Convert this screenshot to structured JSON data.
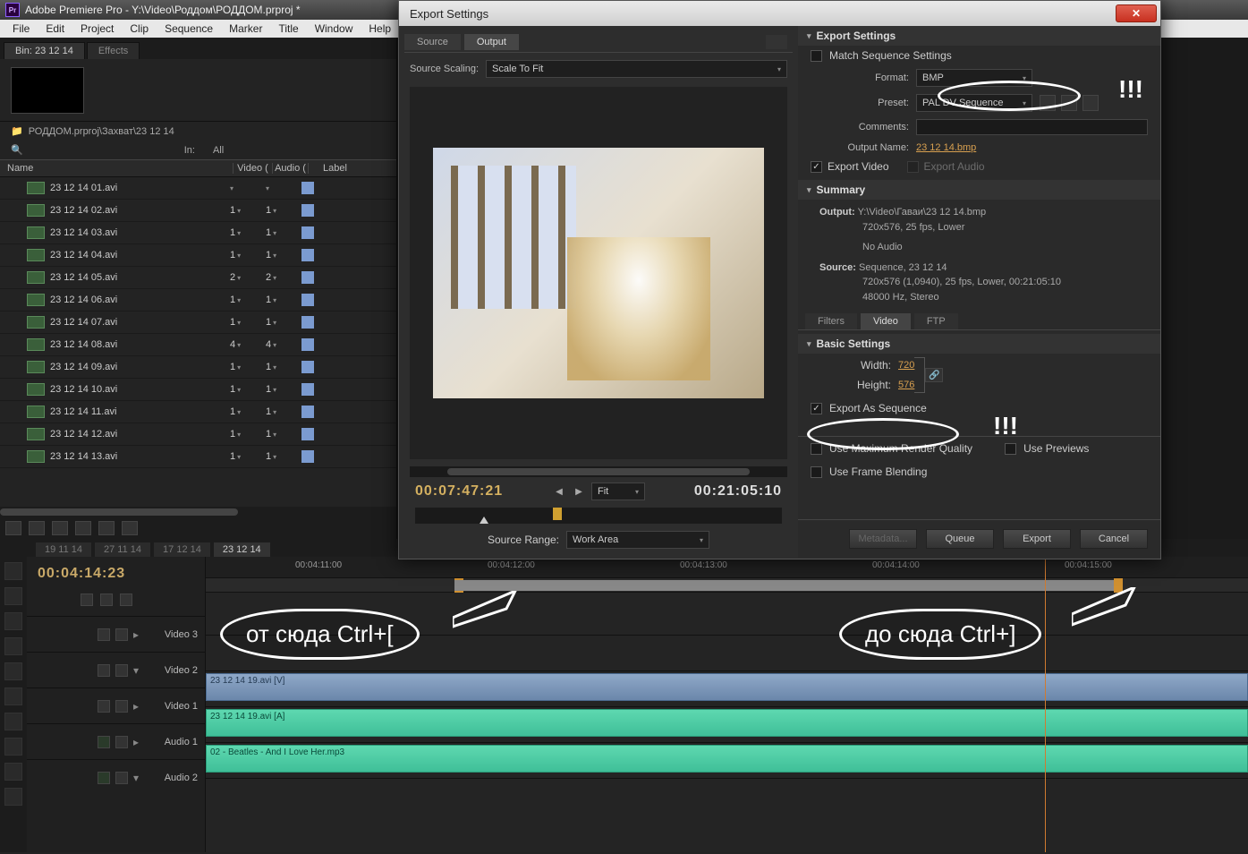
{
  "app": {
    "title": "Adobe Premiere Pro - Y:\\Video\\Роддом\\РОДДОМ.prproj *",
    "logo": "Pr"
  },
  "menu": [
    "File",
    "Edit",
    "Project",
    "Clip",
    "Sequence",
    "Marker",
    "Title",
    "Window",
    "Help"
  ],
  "project": {
    "tabs": [
      {
        "label": "Bin: 23 12 14",
        "active": true
      },
      {
        "label": "Effects",
        "active": false
      }
    ],
    "path_icon": "folder-icon",
    "path": "РОДДОМ.prproj\\Захват\\23 12 14",
    "filter_in": "In:",
    "filter_all": "All",
    "columns": {
      "name": "Name",
      "video": "Video (",
      "audio": "Audio (",
      "label": "Label"
    },
    "files": [
      {
        "name": "23 12 14 01.avi",
        "v": "",
        "a": ""
      },
      {
        "name": "23 12 14 02.avi",
        "v": "1",
        "a": "1"
      },
      {
        "name": "23 12 14 03.avi",
        "v": "1",
        "a": "1"
      },
      {
        "name": "23 12 14 04.avi",
        "v": "1",
        "a": "1"
      },
      {
        "name": "23 12 14 05.avi",
        "v": "2",
        "a": "2"
      },
      {
        "name": "23 12 14 06.avi",
        "v": "1",
        "a": "1"
      },
      {
        "name": "23 12 14 07.avi",
        "v": "1",
        "a": "1"
      },
      {
        "name": "23 12 14 08.avi",
        "v": "4",
        "a": "4"
      },
      {
        "name": "23 12 14 09.avi",
        "v": "1",
        "a": "1"
      },
      {
        "name": "23 12 14 10.avi",
        "v": "1",
        "a": "1"
      },
      {
        "name": "23 12 14 11.avi",
        "v": "1",
        "a": "1"
      },
      {
        "name": "23 12 14 12.avi",
        "v": "1",
        "a": "1"
      },
      {
        "name": "23 12 14 13.avi",
        "v": "1",
        "a": "1"
      }
    ]
  },
  "timeline": {
    "tabs": [
      "19 11 14",
      "27 11 14",
      "17 12 14",
      "23 12 14"
    ],
    "active_tab": 3,
    "timecode": "00:04:14:23",
    "ruler": [
      "00:04:11:00",
      "00:04:12:00",
      "00:04:13:00",
      "00:04:14:00",
      "00:04:15:00"
    ],
    "tracks": {
      "v3": "Video 3",
      "v2": "Video 2",
      "v1": "Video 1",
      "a1": "Audio 1",
      "a2": "Audio 2"
    },
    "clip_v1": "23 12 14 19.avi [V]",
    "clip_a1": "23 12 14 19.avi [A]",
    "clip_a2": "02 - Beatles - And I Love Her.mp3"
  },
  "export": {
    "title": "Export Settings",
    "source_tab": "Source",
    "output_tab": "Output",
    "scaling_label": "Source Scaling:",
    "scaling_value": "Scale To Fit",
    "tc_in": "00:07:47:21",
    "tc_out": "00:21:05:10",
    "fit": "Fit",
    "range_label": "Source Range:",
    "range_value": "Work Area",
    "section": "Export Settings",
    "match_seq": "Match Sequence Settings",
    "format_label": "Format:",
    "format_value": "BMP",
    "preset_label": "Preset:",
    "preset_value": "PAL DV Sequence",
    "comments_label": "Comments:",
    "output_name_label": "Output Name:",
    "output_name": "23 12 14.bmp",
    "export_video": "Export Video",
    "export_audio": "Export Audio",
    "summary_head": "Summary",
    "summary_output_label": "Output:",
    "summary_output_1": "Y:\\Video\\Гаваи\\23 12 14.bmp",
    "summary_output_2": "720x576, 25 fps, Lower",
    "summary_output_3": "No Audio",
    "summary_source_label": "Source:",
    "summary_source_1": "Sequence, 23 12 14",
    "summary_source_2": "720x576 (1,0940), 25 fps, Lower, 00:21:05:10",
    "summary_source_3": "48000 Hz, Stereo",
    "subtabs": [
      "Filters",
      "Video",
      "FTP"
    ],
    "subtab_active": 1,
    "basic_head": "Basic Settings",
    "width_label": "Width:",
    "width_val": "720",
    "height_label": "Height:",
    "height_val": "576",
    "export_as_seq": "Export As Sequence",
    "max_quality": "Use Maximum Render Quality",
    "use_previews": "Use Previews",
    "frame_blend": "Use Frame Blending",
    "metadata_btn": "Metadata...",
    "queue_btn": "Queue",
    "export_btn": "Export",
    "cancel_btn": "Cancel"
  },
  "annotations": {
    "excl": "!!!",
    "from": "от сюда   Ctrl+[",
    "to": "до сюда   Ctrl+]"
  }
}
